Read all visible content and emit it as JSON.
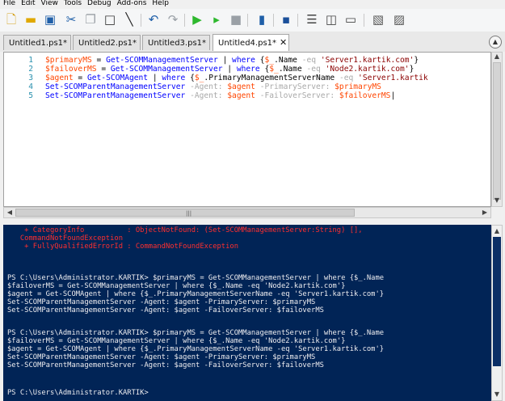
{
  "menu": [
    "File",
    "Edit",
    "View",
    "Tools",
    "Debug",
    "Add-ons",
    "Help"
  ],
  "tabs": [
    {
      "label": "Untitled1.ps1*"
    },
    {
      "label": "Untitled2.ps1*"
    },
    {
      "label": "Untitled3.ps1*"
    },
    {
      "label": "Untitled4.ps1*",
      "close": "✕"
    }
  ],
  "editor": {
    "lines": [
      {
        "n": "1",
        "segs": [
          {
            "t": "$primaryMS",
            "c": "var"
          },
          {
            "t": " = ",
            "c": "txt"
          },
          {
            "t": "Get-SCOMManagementServer",
            "c": "cmd"
          },
          {
            "t": " | ",
            "c": "txt"
          },
          {
            "t": "where",
            "c": "cmd"
          },
          {
            "t": " {",
            "c": "txt"
          },
          {
            "t": "$_",
            "c": "var"
          },
          {
            "t": ".Name ",
            "c": "txt"
          },
          {
            "t": "-eq",
            "c": "op"
          },
          {
            "t": " ",
            "c": "txt"
          },
          {
            "t": "'Server1.kartik.com'",
            "c": "str"
          },
          {
            "t": "}",
            "c": "txt"
          }
        ]
      },
      {
        "n": "2",
        "segs": [
          {
            "t": "$failoverMS",
            "c": "var"
          },
          {
            "t": " = ",
            "c": "txt"
          },
          {
            "t": "Get-SCOMManagementServer",
            "c": "cmd"
          },
          {
            "t": " | ",
            "c": "txt"
          },
          {
            "t": "where",
            "c": "cmd"
          },
          {
            "t": " {",
            "c": "txt"
          },
          {
            "t": "$_",
            "c": "var"
          },
          {
            "t": ".Name ",
            "c": "txt"
          },
          {
            "t": "-eq",
            "c": "op"
          },
          {
            "t": " ",
            "c": "txt"
          },
          {
            "t": "'Node2.kartik.com'",
            "c": "str"
          },
          {
            "t": "}",
            "c": "txt"
          }
        ]
      },
      {
        "n": "3",
        "segs": [
          {
            "t": "$agent",
            "c": "var"
          },
          {
            "t": " = ",
            "c": "txt"
          },
          {
            "t": "Get-SCOMAgent",
            "c": "cmd"
          },
          {
            "t": " | ",
            "c": "txt"
          },
          {
            "t": "where",
            "c": "cmd"
          },
          {
            "t": " {",
            "c": "txt"
          },
          {
            "t": "$_",
            "c": "var"
          },
          {
            "t": ".PrimaryManagementServerName ",
            "c": "txt"
          },
          {
            "t": "-eq",
            "c": "op"
          },
          {
            "t": " ",
            "c": "txt"
          },
          {
            "t": "'Server1.kartik",
            "c": "str"
          }
        ]
      },
      {
        "n": "4",
        "segs": [
          {
            "t": "Set-SCOMParentManagementServer",
            "c": "cmd"
          },
          {
            "t": " ",
            "c": "txt"
          },
          {
            "t": "-Agent:",
            "c": "op"
          },
          {
            "t": " ",
            "c": "txt"
          },
          {
            "t": "$agent",
            "c": "var"
          },
          {
            "t": " ",
            "c": "txt"
          },
          {
            "t": "-PrimaryServer:",
            "c": "op"
          },
          {
            "t": " ",
            "c": "txt"
          },
          {
            "t": "$primaryMS",
            "c": "var"
          }
        ]
      },
      {
        "n": "5",
        "segs": [
          {
            "t": "Set-SCOMParentManagementServer",
            "c": "cmd"
          },
          {
            "t": " ",
            "c": "txt"
          },
          {
            "t": "-Agent:",
            "c": "op"
          },
          {
            "t": " ",
            "c": "txt"
          },
          {
            "t": "$agent",
            "c": "var"
          },
          {
            "t": " ",
            "c": "txt"
          },
          {
            "t": "-FailoverServer:",
            "c": "op"
          },
          {
            "t": " ",
            "c": "txt"
          },
          {
            "t": "$failoverMS",
            "c": "var"
          },
          {
            "t": "|",
            "c": "txt"
          }
        ]
      }
    ]
  },
  "console": {
    "lines": [
      {
        "t": "    + CategoryInfo          : ObjectNotFound: (Set-SCOMManagementServer:String) [],",
        "err": true
      },
      {
        "t": "   CommandNotFoundException",
        "err": true
      },
      {
        "t": "    + FullyQualifiedErrorId : CommandNotFoundException",
        "err": true
      },
      {
        "t": "",
        "err": false
      },
      {
        "t": "",
        "err": false
      },
      {
        "t": "PS C:\\Users\\Administrator.KARTIK> $primaryMS = Get-SCOMManagementServer | where {$_.Name",
        "err": false
      },
      {
        "t": "$failoverMS = Get-SCOMManagementServer | where {$_.Name -eq 'Node2.kartik.com'}",
        "err": false
      },
      {
        "t": "$agent = Get-SCOMAgent | where {$_.PrimaryManagementServerName -eq 'Server1.kartik.com'}",
        "err": false
      },
      {
        "t": "Set-SCOMParentManagementServer -Agent: $agent -PrimaryServer: $primaryMS",
        "err": false
      },
      {
        "t": "Set-SCOMParentManagementServer -Agent: $agent -FailoverServer: $failoverMS",
        "err": false
      },
      {
        "t": "",
        "err": false
      },
      {
        "t": "PS C:\\Users\\Administrator.KARTIK> $primaryMS = Get-SCOMManagementServer | where {$_.Name",
        "err": false
      },
      {
        "t": "$failoverMS = Get-SCOMManagementServer | where {$_.Name -eq 'Node2.kartik.com'}",
        "err": false
      },
      {
        "t": "$agent = Get-SCOMAgent | where {$_.PrimaryManagementServerName -eq 'Server1.kartik.com'}",
        "err": false
      },
      {
        "t": "Set-SCOMParentManagementServer -Agent: $agent -PrimaryServer: $primaryMS",
        "err": false
      },
      {
        "t": "Set-SCOMParentManagementServer -Agent: $agent -FailoverServer: $failoverMS",
        "err": false
      },
      {
        "t": "",
        "err": false
      },
      {
        "t": "PS C:\\Users\\Administrator.KARTIK>",
        "err": false
      }
    ]
  },
  "colors": {
    "console_bg": "#012456",
    "console_text": "#eeedf0",
    "error_text": "#ff2f2f",
    "variable": "#ff4500",
    "command": "#0000ff",
    "operator": "#a9a9a9",
    "string": "#8b0000",
    "line_number": "#2b91af"
  },
  "icons": {
    "new": "new-file-icon",
    "open": "open-folder-icon",
    "save": "save-icon",
    "cut": "cut-icon",
    "copy": "copy-icon",
    "paste": "paste-icon",
    "clear": "clear-console-icon",
    "undo": "undo-icon",
    "redo": "redo-icon",
    "run": "run-script-icon",
    "run_selection": "run-selection-icon",
    "stop": "stop-icon",
    "remote": "remote-powershell-icon",
    "start_powershell": "start-powershell-icon",
    "show_script_top": "show-script-pane-top-icon",
    "show_script_right": "show-script-pane-right-icon",
    "show_script_max": "show-script-pane-maximized-icon",
    "command_addon": "show-command-window-icon",
    "command_addon_pane": "show-command-addon-icon"
  }
}
